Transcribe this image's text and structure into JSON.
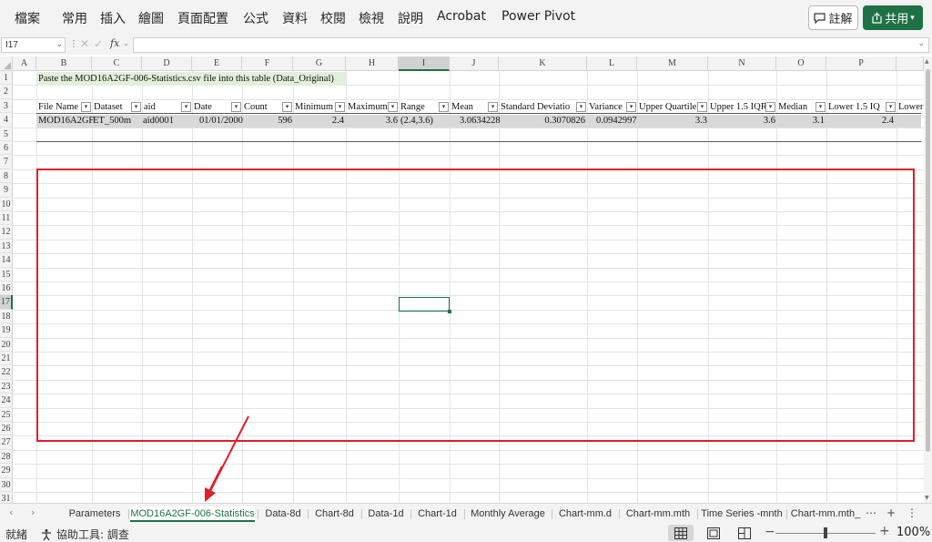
{
  "ribbon": {
    "tabs": [
      "檔案",
      "常用",
      "插入",
      "繪圖",
      "頁面配置",
      "公式",
      "資料",
      "校閱",
      "檢視",
      "說明",
      "Acrobat",
      "Power Pivot"
    ],
    "comment_label": "註解",
    "share_label": "共用"
  },
  "formula_bar": {
    "name_box": "I17",
    "fx_label": "fx",
    "formula": ""
  },
  "grid": {
    "columns": [
      "A",
      "B",
      "C",
      "D",
      "E",
      "F",
      "G",
      "H",
      "I",
      "J",
      "K",
      "L",
      "M",
      "N",
      "O",
      "P"
    ],
    "rows": [
      "1",
      "2",
      "3",
      "4",
      "5",
      "6",
      "7",
      "8",
      "9",
      "10",
      "11",
      "12",
      "13",
      "14",
      "15",
      "16",
      "17",
      "18",
      "19",
      "20",
      "21",
      "22",
      "23",
      "24",
      "25",
      "26",
      "27",
      "28",
      "29",
      "30",
      "31"
    ],
    "selected_column": "I",
    "selected_row": "17",
    "note_text": "Paste the MOD16A2GF-006-Statistics.csv file into this table (Data_Original)",
    "table_headers": [
      "File Name",
      "Dataset",
      "aid",
      "Date",
      "Count",
      "Minimum",
      "Maximum",
      "Range",
      "Mean",
      "Standard Deviatio",
      "Variance",
      "Upper Quartile",
      "Upper 1.5 IQR",
      "Median",
      "Lower 1.5 IQ",
      "Lower"
    ],
    "data_row": {
      "file_name": "MOD16A2GF",
      "dataset": "ET_500m",
      "aid": "aid0001",
      "date": "01/01/2000",
      "count": "596",
      "minimum": "2.4",
      "maximum": "3.6",
      "range": "(2.4,3.6)",
      "mean": "3.0634228",
      "std_dev": "0.3070826",
      "variance": "0.0942997",
      "upper_quartile": "3.3",
      "upper_iqr": "3.6",
      "median": "3.1",
      "lower_iqr": "2.4"
    }
  },
  "sheet_tabs": [
    "Parameters",
    "MOD16A2GF-006-Statistics",
    "Data-8d",
    "Chart-8d",
    "Data-1d",
    "Chart-1d",
    "Monthly Average",
    "Chart-mm.d",
    "Chart-mm.mth",
    "Time Series -mnth",
    "Chart-mm.mth_"
  ],
  "active_sheet": "MOD16A2GF-006-Statistics",
  "status_bar": {
    "ready": "就緒",
    "accessibility": "協助工具: 調查",
    "zoom": "100%"
  },
  "colors": {
    "accent_green": "#1e7145",
    "highlight_red": "#e01f26",
    "note_fill": "#e2efda"
  }
}
